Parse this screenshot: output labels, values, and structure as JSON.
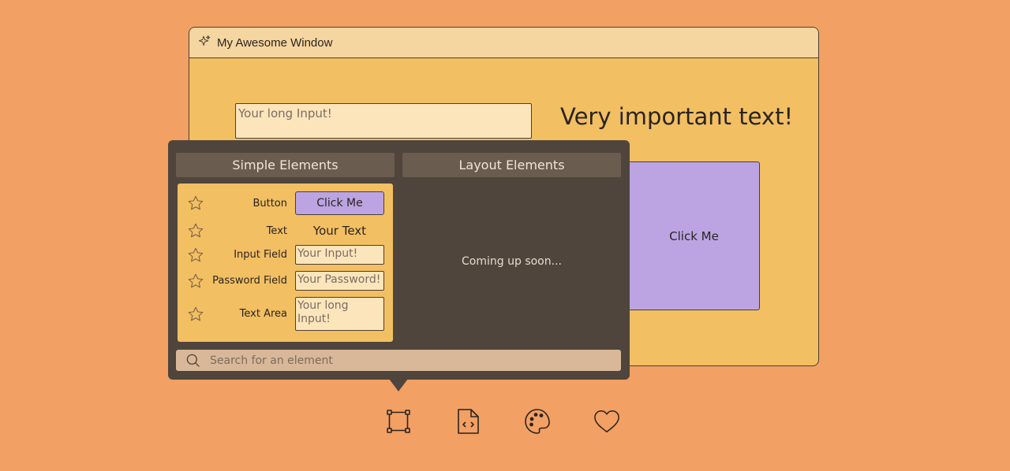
{
  "window": {
    "title": "My Awesome Window",
    "input_placeholder": "Your long Input!",
    "important_text": "Very important text!",
    "button_label": "Click Me"
  },
  "popover": {
    "tabs": [
      "Simple Elements",
      "Layout Elements"
    ],
    "simple_elements": [
      {
        "label": "Button",
        "preview": "Click Me"
      },
      {
        "label": "Text",
        "preview": "Your Text"
      },
      {
        "label": "Input Field",
        "preview": "Your Input!"
      },
      {
        "label": "Password Field",
        "preview": "Your Password!"
      },
      {
        "label": "Text Area",
        "preview": "Your long Input!"
      }
    ],
    "layout_placeholder": "Coming up soon...",
    "search_placeholder": "Search for an element"
  },
  "toolbar": {
    "icons": [
      "select-frame-icon",
      "code-file-icon",
      "palette-icon",
      "heart-icon"
    ]
  },
  "colors": {
    "background": "#f2a063",
    "window": "#f2bf63",
    "titlebar": "#f5d5a0",
    "popover": "#4f453c",
    "button": "#bca4e3",
    "input": "#fde5bb"
  }
}
